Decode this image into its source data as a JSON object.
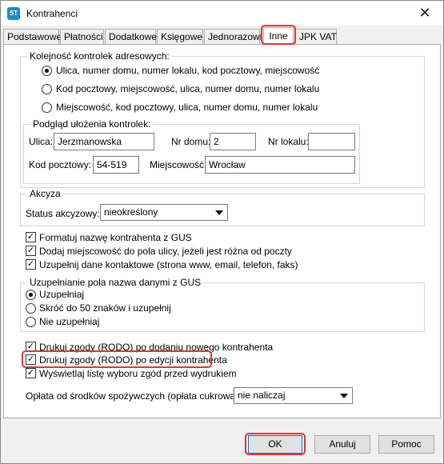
{
  "window": {
    "title": "Kontrahenci",
    "close_glyph": "✕"
  },
  "tabs": [
    {
      "label": "Podstawowe"
    },
    {
      "label": "Płatności"
    },
    {
      "label": "Dodatkowe"
    },
    {
      "label": "Księgowe"
    },
    {
      "label": "Jednorazowi"
    },
    {
      "label": "Inne"
    },
    {
      "label": "JPK VAT"
    }
  ],
  "active_tab": "Inne",
  "address_order": {
    "legend": "Kolejność kontrolek adresowych:",
    "options": [
      {
        "label": "Ulica, numer domu, numer lokalu, kod pocztowy, miejscowość",
        "selected": true
      },
      {
        "label": "Kod pocztowy, miejscowość, ulica, numer domu, numer lokalu",
        "selected": false
      },
      {
        "label": "Miejscowość, kod pocztowy, ulica, numer domu, numer lokalu",
        "selected": false
      }
    ],
    "preview": {
      "legend": "Podgląd ułożenia kontrolek:",
      "street_label": "Ulica:",
      "street_value": "Jerzmanowska",
      "house_label": "Nr domu:",
      "house_value": "2",
      "flat_label": "Nr lokalu:",
      "flat_value": "",
      "postal_label": "Kod pocztowy:",
      "postal_value": "54-519",
      "city_label": "Miejscowość:",
      "city_value": "Wrocław"
    }
  },
  "excise": {
    "legend": "Akcyza",
    "status_label": "Status akcyzowy:",
    "status_value": "nieokreślony"
  },
  "checks1": [
    {
      "label": "Formatuj nazwę kontrahenta z GUS",
      "checked": true
    },
    {
      "label": "Dodaj miejscowość do pola ulicy, jeżeli jest różna od poczty",
      "checked": true
    },
    {
      "label": "Uzupełnij dane kontaktowe (strona www, email, telefon, faks)",
      "checked": true
    }
  ],
  "gus_name": {
    "legend": "Uzupełnianie pola nazwa danymi z GUS",
    "options": [
      {
        "label": "Uzupełniaj",
        "selected": true
      },
      {
        "label": "Skróć do 50 znaków i uzupełnij",
        "selected": false
      },
      {
        "label": "Nie uzupełniaj",
        "selected": false
      }
    ]
  },
  "checks2": [
    {
      "label": "Drukuj zgody (RODO) po dodaniu nowego kontrahenta",
      "checked": true
    },
    {
      "label": "Drukuj zgody (RODO) po edycji kontrahenta",
      "checked": true
    },
    {
      "label": "Wyświetlaj listę wyboru zgód przed wydrukiem",
      "checked": true
    }
  ],
  "sugar_fee": {
    "label": "Opłata od środków spożywczych (opłata cukrowa):",
    "value": "nie naliczaj"
  },
  "buttons": {
    "ok": "OK",
    "cancel": "Anuluj",
    "help": "Pomoc"
  },
  "colors": {
    "highlight": "#e53333",
    "accent": "#0078d7"
  }
}
